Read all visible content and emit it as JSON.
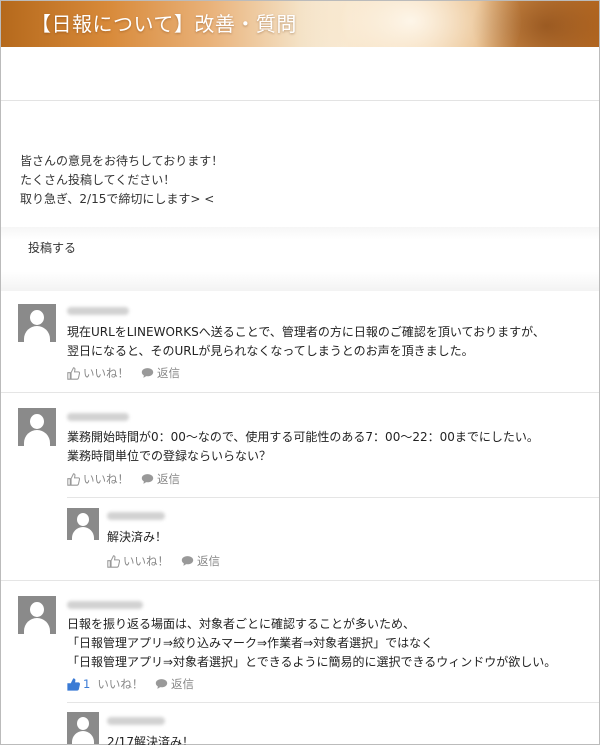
{
  "header": {
    "title": "【日報について】改善・質問"
  },
  "intro": {
    "lines": [
      "皆さんの意見をお待ちしております！",
      "たくさん投稿してください！",
      "取り急ぎ、2/15で締切にします> <"
    ]
  },
  "post_button": {
    "label": "投稿する"
  },
  "posts": [
    {
      "lines": [
        "現在URLをLINEWORKSへ送ることで、管理者の方に日報のご確認を頂いておりますが、",
        "翌日になると、そのURLが見られなくなってしまうとのお声を頂きました。"
      ],
      "like_label": "いいね！",
      "reply_label": "返信"
    },
    {
      "lines": [
        "業務開始時間が0：00～なので、使用する可能性のある7：00～22：00までにしたい。",
        "業務時間単位での登録ならいらない？"
      ],
      "like_label": "いいね！",
      "reply_label": "返信",
      "reply": {
        "lines": [
          "解決済み！"
        ],
        "like_label": "いいね！",
        "reply_label": "返信"
      }
    },
    {
      "lines": [
        "日報を振り返る場面は、対象者ごとに確認することが多いため、",
        "「日報管理アプリ⇒絞り込みマーク⇒作業者⇒対象者選択」ではなく",
        "「日報管理アプリ⇒対象者選択」とできるように簡易的に選択できるウィンドウが欲しい。"
      ],
      "like_count": "1",
      "like_label": "いいね！",
      "reply_label": "返信",
      "reply": {
        "lines": [
          "2/17解決済み！"
        ]
      }
    }
  ],
  "colors": {
    "like_active": "#3a7bd5",
    "action_gray": "#888888",
    "avatar_gray": "#8a8a8a"
  }
}
